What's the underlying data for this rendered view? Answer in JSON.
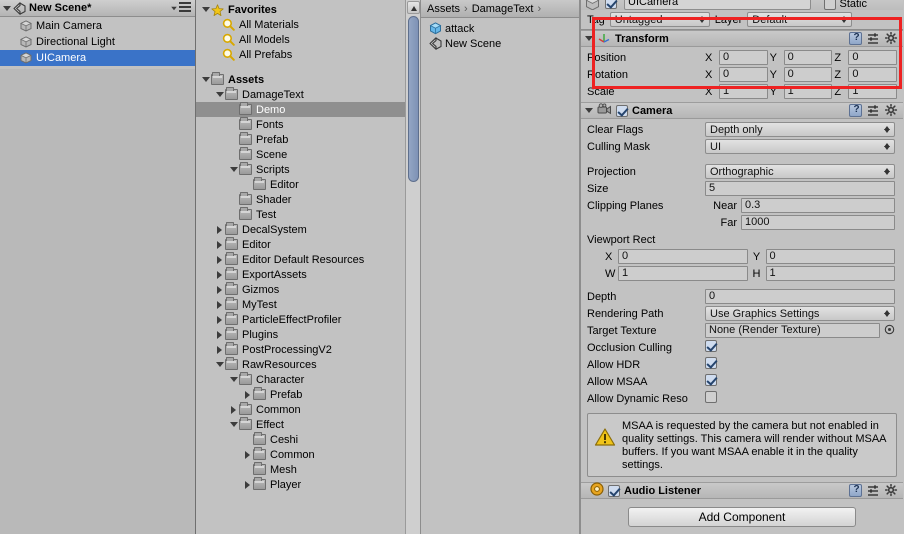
{
  "hierarchy": {
    "scene_name": "New Scene*",
    "menu_icon": "hamburger-menu-icon",
    "items": [
      {
        "label": "Main Camera",
        "icon": "gameobject-cube-icon",
        "selected": false
      },
      {
        "label": "Directional Light",
        "icon": "gameobject-cube-icon",
        "selected": false
      },
      {
        "label": "UICamera",
        "icon": "gameobject-cube-icon",
        "selected": true
      }
    ]
  },
  "project_tree": {
    "favorites": {
      "label": "Favorites",
      "icon": "star-icon",
      "items": [
        {
          "label": "All Materials",
          "icon": "search-icon"
        },
        {
          "label": "All Models",
          "icon": "search-icon"
        },
        {
          "label": "All Prefabs",
          "icon": "search-icon"
        }
      ]
    },
    "assets": {
      "label": "Assets",
      "icon": "folder-icon",
      "items": [
        {
          "label": "DamageText",
          "indent": 1,
          "expanded": true,
          "selected": false
        },
        {
          "label": "Demo",
          "indent": 2,
          "expanded": null,
          "selected": true
        },
        {
          "label": "Fonts",
          "indent": 2,
          "expanded": null,
          "selected": false
        },
        {
          "label": "Prefab",
          "indent": 2,
          "expanded": null,
          "selected": false
        },
        {
          "label": "Scene",
          "indent": 2,
          "expanded": null,
          "selected": false
        },
        {
          "label": "Scripts",
          "indent": 2,
          "expanded": true,
          "selected": false
        },
        {
          "label": "Editor",
          "indent": 3,
          "expanded": null,
          "selected": false
        },
        {
          "label": "Shader",
          "indent": 2,
          "expanded": null,
          "selected": false
        },
        {
          "label": "Test",
          "indent": 2,
          "expanded": null,
          "selected": false
        },
        {
          "label": "DecalSystem",
          "indent": 1,
          "expanded": false,
          "selected": false
        },
        {
          "label": "Editor",
          "indent": 1,
          "expanded": false,
          "selected": false
        },
        {
          "label": "Editor Default Resources",
          "indent": 1,
          "expanded": false,
          "selected": false
        },
        {
          "label": "ExportAssets",
          "indent": 1,
          "expanded": false,
          "selected": false
        },
        {
          "label": "Gizmos",
          "indent": 1,
          "expanded": false,
          "selected": false
        },
        {
          "label": "MyTest",
          "indent": 1,
          "expanded": false,
          "selected": false
        },
        {
          "label": "ParticleEffectProfiler",
          "indent": 1,
          "expanded": false,
          "selected": false
        },
        {
          "label": "Plugins",
          "indent": 1,
          "expanded": false,
          "selected": false
        },
        {
          "label": "PostProcessingV2",
          "indent": 1,
          "expanded": false,
          "selected": false
        },
        {
          "label": "RawResources",
          "indent": 1,
          "expanded": true,
          "selected": false
        },
        {
          "label": "Character",
          "indent": 2,
          "expanded": true,
          "selected": false
        },
        {
          "label": "Prefab",
          "indent": 3,
          "expanded": false,
          "selected": false
        },
        {
          "label": "Common",
          "indent": 2,
          "expanded": false,
          "selected": false
        },
        {
          "label": "Effect",
          "indent": 2,
          "expanded": true,
          "selected": false
        },
        {
          "label": "Ceshi",
          "indent": 3,
          "expanded": null,
          "selected": false
        },
        {
          "label": "Common",
          "indent": 3,
          "expanded": false,
          "selected": false
        },
        {
          "label": "Mesh",
          "indent": 3,
          "expanded": null,
          "selected": false
        },
        {
          "label": "Player",
          "indent": 3,
          "expanded": false,
          "selected": false
        }
      ]
    }
  },
  "project_content": {
    "breadcrumb": [
      "Assets",
      "DamageText"
    ],
    "items": [
      {
        "label": "attack",
        "icon": "prefab-cube-icon"
      },
      {
        "label": "New Scene",
        "icon": "unity-scene-icon"
      }
    ]
  },
  "inspector": {
    "object_name": "UICamera",
    "object_enabled": true,
    "static_label": "Static",
    "static_checked": false,
    "tag_label": "Tag",
    "tag_value": "Untagged",
    "layer_label": "Layer",
    "layer_value": "Default",
    "transform": {
      "title": "Transform",
      "icon": "transform-axis-icon",
      "rows": [
        {
          "name": "Position",
          "x": "0",
          "y": "0",
          "z": "0"
        },
        {
          "name": "Rotation",
          "x": "0",
          "y": "0",
          "z": "0"
        },
        {
          "name": "Scale",
          "x": "1",
          "y": "1",
          "z": "1"
        }
      ],
      "axis_labels": [
        "X",
        "Y",
        "Z"
      ]
    },
    "camera": {
      "title": "Camera",
      "icon": "camera-icon",
      "enabled": true,
      "clear_flags_label": "Clear Flags",
      "clear_flags_value": "Depth only",
      "culling_mask_label": "Culling Mask",
      "culling_mask_value": "UI",
      "projection_label": "Projection",
      "projection_value": "Orthographic",
      "size_label": "Size",
      "size_value": "5",
      "clipping_label": "Clipping Planes",
      "near_label": "Near",
      "near_value": "0.3",
      "far_label": "Far",
      "far_value": "1000",
      "viewport_label": "Viewport Rect",
      "viewport_x_label": "X",
      "viewport_x_value": "0",
      "viewport_y_label": "Y",
      "viewport_y_value": "0",
      "viewport_w_label": "W",
      "viewport_w_value": "1",
      "viewport_h_label": "H",
      "viewport_h_value": "1",
      "depth_label": "Depth",
      "depth_value": "0",
      "rendering_path_label": "Rendering Path",
      "rendering_path_value": "Use Graphics Settings",
      "target_texture_label": "Target Texture",
      "target_texture_value": "None (Render Texture)",
      "occlusion_label": "Occlusion Culling",
      "occlusion_checked": true,
      "hdr_label": "Allow HDR",
      "hdr_checked": true,
      "msaa_label": "Allow MSAA",
      "msaa_checked": true,
      "dynamic_res_label": "Allow Dynamic Reso",
      "dynamic_res_checked": false,
      "highlight_color": "#ee2222"
    },
    "warning": {
      "icon": "warning-triangle-icon",
      "text": "MSAA is requested by the camera but not enabled in quality settings. This camera will render without MSAA buffers. If you want MSAA enable it in the quality settings."
    },
    "audio_listener": {
      "title": "Audio Listener",
      "icon": "audio-listener-icon",
      "enabled": true
    },
    "add_component_label": "Add Component"
  }
}
